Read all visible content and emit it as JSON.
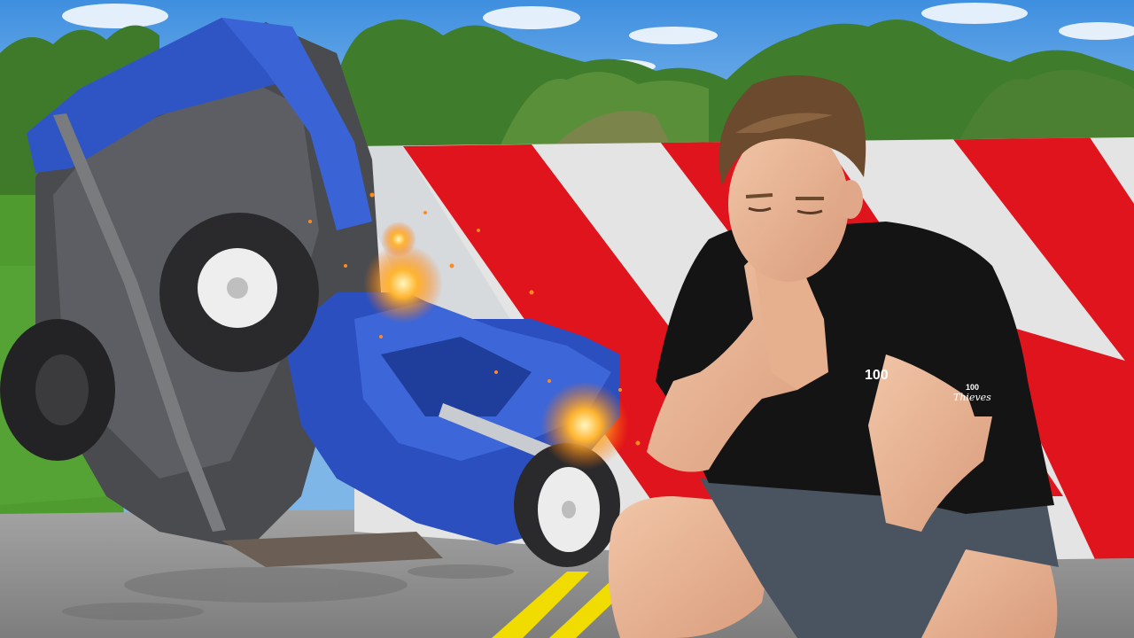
{
  "scene": {
    "description_free": true,
    "colors": {
      "sky": "#5fa3e6",
      "barrier_red": "#e0141c",
      "barrier_white": "#e6e6e6",
      "car_blue": "#2f55c4",
      "road": "#8f8f8f",
      "road_line": "#f2e000",
      "grass": "#4f9b2f",
      "shirt": "#141414",
      "shorts": "#4a5461"
    },
    "shirt": {
      "chest_logo": "100",
      "sleeve_logo_top": "100",
      "sleeve_logo_bottom": "Thieves"
    }
  }
}
